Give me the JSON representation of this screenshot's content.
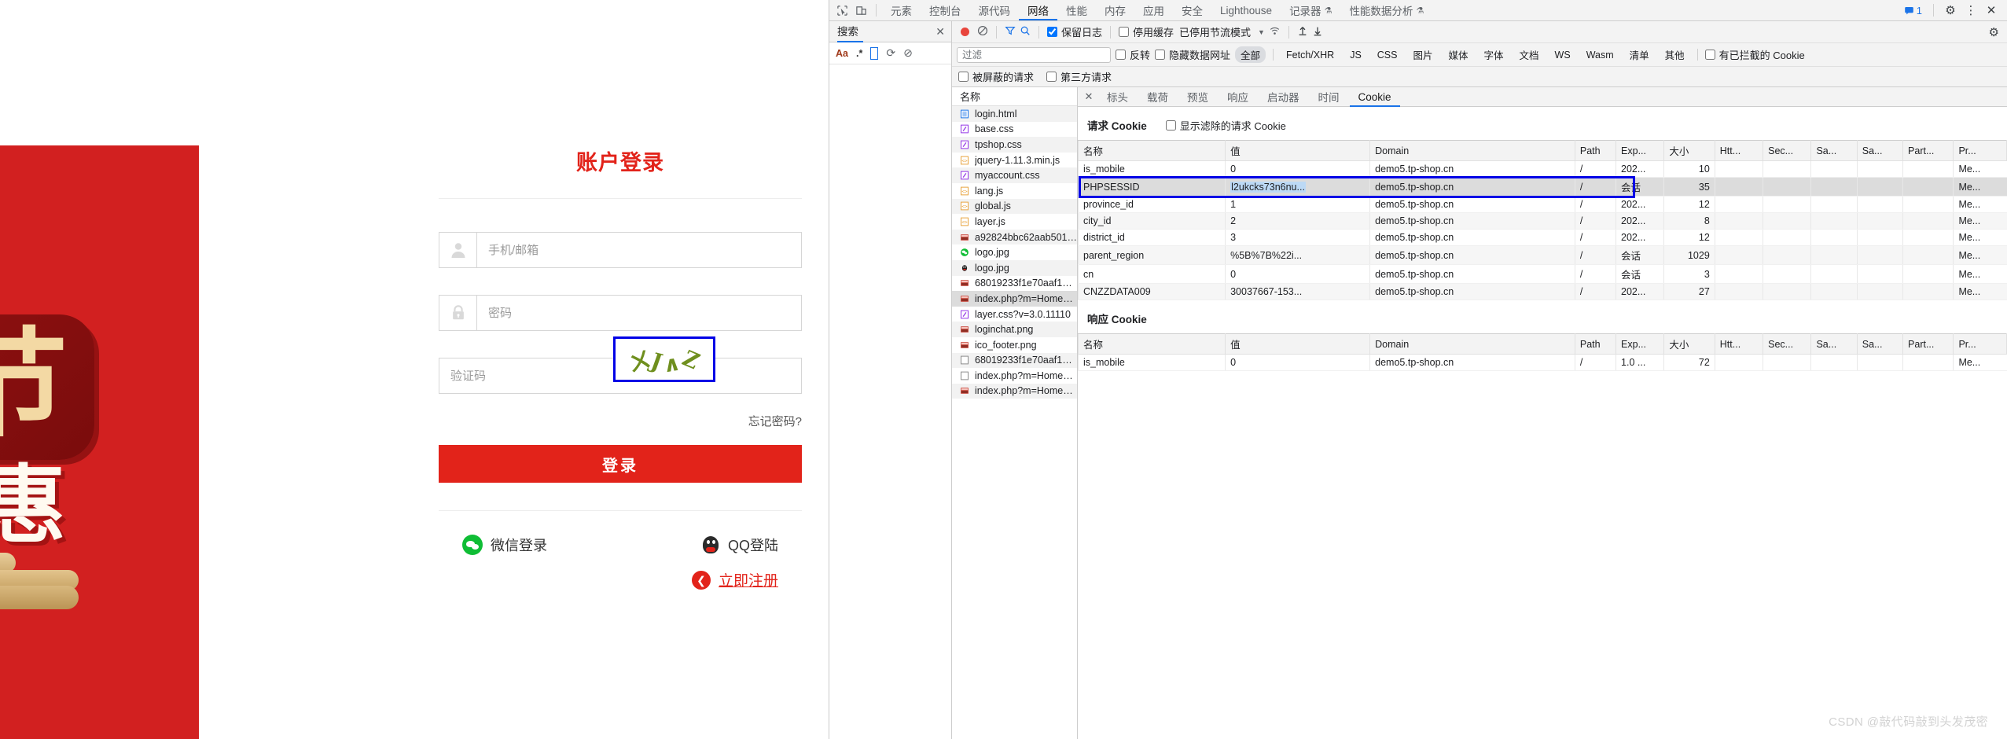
{
  "login": {
    "title": "账户登录",
    "username": {
      "placeholder": "手机/邮箱",
      "value": ""
    },
    "password": {
      "placeholder": "密码",
      "value": ""
    },
    "captcha": {
      "placeholder": "验证码",
      "value": "",
      "image_chars": [
        "ㄨ",
        "J",
        "∧",
        "Z"
      ]
    },
    "forgot_label": "忘记密码?",
    "login_button": "登录",
    "wechat_label": "微信登录",
    "qq_label": "QQ登陆",
    "register_label": "立即注册",
    "accent_color": "#e2231a",
    "banner": {
      "char_badge": "节",
      "char_big": "惠",
      "bg_color": "#d22020"
    }
  },
  "devtools": {
    "tabs": [
      {
        "label": "元素",
        "active": false
      },
      {
        "label": "控制台",
        "active": false
      },
      {
        "label": "源代码",
        "active": false
      },
      {
        "label": "网络",
        "active": true
      },
      {
        "label": "性能",
        "active": false
      },
      {
        "label": "内存",
        "active": false
      },
      {
        "label": "应用",
        "active": false
      },
      {
        "label": "安全",
        "active": false
      },
      {
        "label": "Lighthouse",
        "active": false
      },
      {
        "label": "记录器",
        "active": false,
        "experimental": true
      },
      {
        "label": "性能数据分析",
        "active": false,
        "experimental": true
      }
    ],
    "message_count": "1",
    "icons": {
      "inspect": "inspect-element-icon",
      "device": "device-toolbar-icon",
      "messages": "messages-icon",
      "settings": "gear-icon",
      "more": "kebab-menu-icon",
      "close": "close-icon"
    },
    "search_pane": {
      "title": "搜索",
      "match_case": "Aa",
      "regex": ".*",
      "query": "",
      "refresh_icon": "refresh-icon",
      "clear_icon": "clear-icon",
      "close_icon": "close-icon"
    },
    "network_toolbar": {
      "record_icon": "record-stop-icon",
      "clear_icon": "clear-network-icon",
      "filter_icon": "filter-funnel-icon",
      "search_icon": "search-icon",
      "preserve_log": {
        "label": "保留日志",
        "checked": true
      },
      "disable_cache": {
        "label": "停用缓存",
        "checked": false
      },
      "throttle": "已停用节流模式",
      "wifi_icon": "network-conditions-icon",
      "import_icon": "import-har-icon",
      "export_icon": "export-har-icon",
      "settings_icon": "gear-icon"
    },
    "filter_bar": {
      "filter_placeholder": "过滤",
      "invert": {
        "label": "反转",
        "checked": false
      },
      "hide_data_urls": {
        "label": "隐藏数据网址",
        "checked": false
      },
      "types": [
        "全部",
        "Fetch/XHR",
        "JS",
        "CSS",
        "图片",
        "媒体",
        "字体",
        "文档",
        "WS",
        "Wasm",
        "清单",
        "其他"
      ],
      "active_type": "全部",
      "blocked_cookies": {
        "label": "有已拦截的 Cookie",
        "checked": false
      },
      "blocked_requests": {
        "label": "被屏蔽的请求",
        "checked": false
      },
      "third_party": {
        "label": "第三方请求",
        "checked": false
      }
    },
    "request_list": {
      "header": "名称",
      "items": [
        {
          "name": "login.html",
          "type": "doc",
          "selected": false
        },
        {
          "name": "base.css",
          "type": "css",
          "selected": false
        },
        {
          "name": "tpshop.css",
          "type": "css",
          "selected": false
        },
        {
          "name": "jquery-1.11.3.min.js",
          "type": "js",
          "selected": false
        },
        {
          "name": "myaccount.css",
          "type": "css",
          "selected": false
        },
        {
          "name": "lang.js",
          "type": "js",
          "selected": false
        },
        {
          "name": "global.js",
          "type": "js",
          "selected": false
        },
        {
          "name": "layer.js",
          "type": "js",
          "selected": false
        },
        {
          "name": "a92824bbc62aab5016d3...",
          "type": "img",
          "selected": false
        },
        {
          "name": "logo.jpg",
          "type": "img-wechat",
          "selected": false
        },
        {
          "name": "logo.jpg",
          "type": "img-qq",
          "selected": false
        },
        {
          "name": "68019233f1e70aaf16ae9...",
          "type": "img",
          "selected": false
        },
        {
          "name": "index.php?m=Home&c...",
          "type": "img",
          "selected": true
        },
        {
          "name": "layer.css?v=3.0.11110",
          "type": "css",
          "selected": false
        },
        {
          "name": "loginchat.png",
          "type": "img",
          "selected": false
        },
        {
          "name": "ico_footer.png",
          "type": "img",
          "selected": false
        },
        {
          "name": "68019233f1e70aaf16ae9...",
          "type": "other",
          "selected": false
        },
        {
          "name": "index.php?m=Home&c...",
          "type": "other",
          "selected": false
        },
        {
          "name": "index.php?m=Home&c...",
          "type": "img",
          "selected": false
        }
      ]
    },
    "detail_tabs": [
      {
        "label": "标头",
        "active": false
      },
      {
        "label": "载荷",
        "active": false
      },
      {
        "label": "预览",
        "active": false
      },
      {
        "label": "响应",
        "active": false
      },
      {
        "label": "启动器",
        "active": false
      },
      {
        "label": "时间",
        "active": false
      },
      {
        "label": "Cookie",
        "active": true
      }
    ],
    "cookies": {
      "request": {
        "title": "请求 Cookie",
        "show_filtered": {
          "label": "显示滤除的请求 Cookie",
          "checked": false
        },
        "columns": [
          "名称",
          "值",
          "Domain",
          "Path",
          "Exp...",
          "大小",
          "Htt...",
          "Sec...",
          "Sa...",
          "Sa...",
          "Part...",
          "Pr..."
        ],
        "rows": [
          {
            "name": "is_mobile",
            "value": "0",
            "domain": "demo5.tp-shop.cn",
            "path": "/",
            "expires": "202...",
            "size": "10",
            "http_only": "",
            "secure": "",
            "same_site": "",
            "same_party": "",
            "partition": "",
            "priority": "Me...",
            "selected": false
          },
          {
            "name": "PHPSESSID",
            "value": "l2ukcks73n6nu...",
            "domain": "demo5.tp-shop.cn",
            "path": "/",
            "expires": "会话",
            "size": "35",
            "http_only": "",
            "secure": "",
            "same_site": "",
            "same_party": "",
            "partition": "",
            "priority": "Me...",
            "selected": true
          },
          {
            "name": "province_id",
            "value": "1",
            "domain": "demo5.tp-shop.cn",
            "path": "/",
            "expires": "202...",
            "size": "12",
            "http_only": "",
            "secure": "",
            "same_site": "",
            "same_party": "",
            "partition": "",
            "priority": "Me...",
            "selected": false
          },
          {
            "name": "city_id",
            "value": "2",
            "domain": "demo5.tp-shop.cn",
            "path": "/",
            "expires": "202...",
            "size": "8",
            "http_only": "",
            "secure": "",
            "same_site": "",
            "same_party": "",
            "partition": "",
            "priority": "Me...",
            "selected": false
          },
          {
            "name": "district_id",
            "value": "3",
            "domain": "demo5.tp-shop.cn",
            "path": "/",
            "expires": "202...",
            "size": "12",
            "http_only": "",
            "secure": "",
            "same_site": "",
            "same_party": "",
            "partition": "",
            "priority": "Me...",
            "selected": false
          },
          {
            "name": "parent_region",
            "value": "%5B%7B%22i...",
            "domain": "demo5.tp-shop.cn",
            "path": "/",
            "expires": "会话",
            "size": "1029",
            "http_only": "",
            "secure": "",
            "same_site": "",
            "same_party": "",
            "partition": "",
            "priority": "Me...",
            "selected": false
          },
          {
            "name": "cn",
            "value": "0",
            "domain": "demo5.tp-shop.cn",
            "path": "/",
            "expires": "会话",
            "size": "3",
            "http_only": "",
            "secure": "",
            "same_site": "",
            "same_party": "",
            "partition": "",
            "priority": "Me...",
            "selected": false
          },
          {
            "name": "CNZZDATA009",
            "value": "30037667-153...",
            "domain": "demo5.tp-shop.cn",
            "path": "/",
            "expires": "202...",
            "size": "27",
            "http_only": "",
            "secure": "",
            "same_site": "",
            "same_party": "",
            "partition": "",
            "priority": "Me...",
            "selected": false
          }
        ]
      },
      "response": {
        "title": "响应 Cookie",
        "columns": [
          "名称",
          "值",
          "Domain",
          "Path",
          "Exp...",
          "大小",
          "Htt...",
          "Sec...",
          "Sa...",
          "Sa...",
          "Part...",
          "Pr..."
        ],
        "rows": [
          {
            "name": "is_mobile",
            "value": "0",
            "domain": "demo5.tp-shop.cn",
            "path": "/",
            "expires": "1.0 ...",
            "size": "72",
            "http_only": "",
            "secure": "",
            "same_site": "",
            "same_party": "",
            "partition": "",
            "priority": "Me...",
            "selected": false
          }
        ]
      }
    }
  },
  "watermark": "CSDN @敲代码敲到头发茂密"
}
